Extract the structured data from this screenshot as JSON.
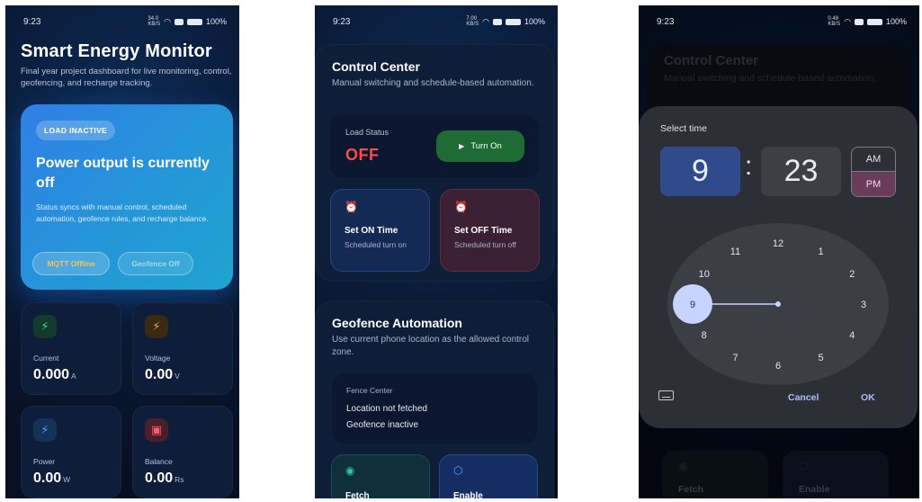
{
  "statusbar": {
    "time": "9:23",
    "phone1_net": "34.0\nKB/S",
    "phone2_net": "7.00\nKB/S",
    "phone3_net": "0.48\nKB/S",
    "battery": "100%"
  },
  "dashboard": {
    "title": "Smart Energy Monitor",
    "subtitle": "Final year project dashboard for live monitoring, control, geofencing, and recharge tracking.",
    "hero": {
      "badge": "LOAD INACTIVE",
      "heading": "Power output is currently off",
      "description": "Status syncs with manual control, scheduled automation, geofence rules, and recharge balance.",
      "mqtt_pill": "MQTT Offline",
      "geofence_pill": "Geofence Off"
    },
    "metrics": [
      {
        "label": "Current",
        "value": "0.000",
        "unit": "A",
        "icon": "bolt-icon",
        "color": "#3ddc84"
      },
      {
        "label": "Voltage",
        "value": "0.00",
        "unit": "V",
        "icon": "flash-icon",
        "color": "#f5a524"
      },
      {
        "label": "Power",
        "value": "0.00",
        "unit": "W",
        "icon": "power-bolt-icon",
        "color": "#4ea5ff"
      },
      {
        "label": "Balance",
        "value": "0.00",
        "unit": "Rs",
        "icon": "wallet-icon",
        "color": "#ff5a6e"
      }
    ]
  },
  "control": {
    "title": "Control Center",
    "subtitle": "Manual switching and schedule-based automation.",
    "load_status_label": "Load Status",
    "load_status_value": "OFF",
    "turn_on_label": "Turn On",
    "set_on": {
      "title": "Set ON Time",
      "subtitle": "Scheduled turn on"
    },
    "set_off": {
      "title": "Set OFF Time",
      "subtitle": "Scheduled turn off"
    }
  },
  "geofence": {
    "title": "Geofence Automation",
    "subtitle": "Use current phone location as the allowed control zone.",
    "fence_center_label": "Fence Center",
    "location_status": "Location not fetched",
    "geofence_status": "Geofence inactive",
    "fetch_label": "Fetch",
    "enable_label": "Enable"
  },
  "time_picker": {
    "heading": "Select time",
    "hour": "9",
    "separator": ":",
    "minute": "23",
    "am": "AM",
    "pm": "PM",
    "selected_period": "PM",
    "selected_hour": 9,
    "clock_numbers": [
      "12",
      "1",
      "2",
      "3",
      "4",
      "5",
      "6",
      "7",
      "8",
      "9",
      "10",
      "11"
    ],
    "cancel_label": "Cancel",
    "ok_label": "OK"
  },
  "colors": {
    "background": "#0a1a36",
    "accent_blue": "#2f7fe6",
    "off_red": "#ff4a4a",
    "turn_on_green": "#1f6b35",
    "dialog": "#2c2f35",
    "selection": "#c6d4ff"
  }
}
